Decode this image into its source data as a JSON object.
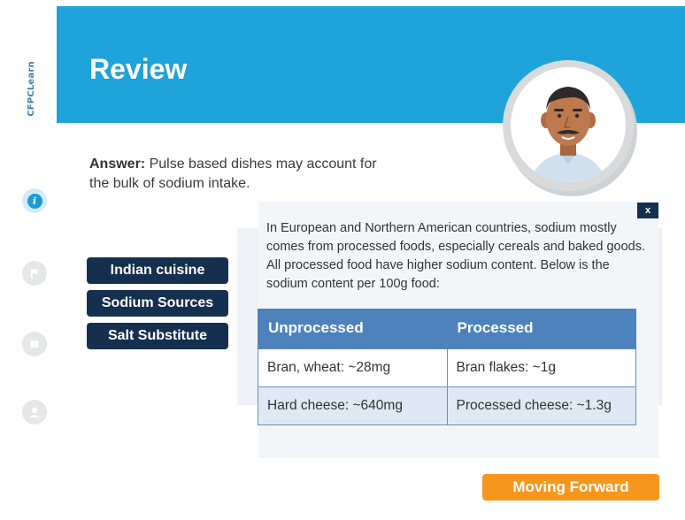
{
  "brand": {
    "name": "CFPCLearn"
  },
  "header": {
    "title": "Review"
  },
  "answer": {
    "label": "Answer:",
    "text": " Pulse based dishes may account for the bulk of sodium intake."
  },
  "topics": [
    {
      "label": "Indian cuisine"
    },
    {
      "label": "Sodium Sources"
    },
    {
      "label": "Salt Substitute"
    }
  ],
  "popup": {
    "close_label": "x",
    "text": "In European and Northern American countries, sodium mostly comes from processed foods, especially cereals and baked goods. All processed food have higher sodium content.  Below is the sodium content per 100g food:",
    "table": {
      "headers": [
        "Unprocessed",
        "Processed"
      ],
      "rows": [
        [
          "Bran, wheat: ~28mg",
          "Bran flakes: ~1g"
        ],
        [
          "Hard cheese: ~640mg",
          "Processed cheese: ~1.3g"
        ]
      ]
    }
  },
  "footer": {
    "next_label": "Moving Forward"
  },
  "icons": {
    "info": "info-icon",
    "flag": "flag-icon",
    "book": "book-icon",
    "user": "user-icon",
    "avatar": "doctor-avatar"
  },
  "colors": {
    "header": "#1ea3da",
    "button_dark": "#15304f",
    "table_header": "#4e82bc",
    "accent_orange": "#f7961d"
  }
}
